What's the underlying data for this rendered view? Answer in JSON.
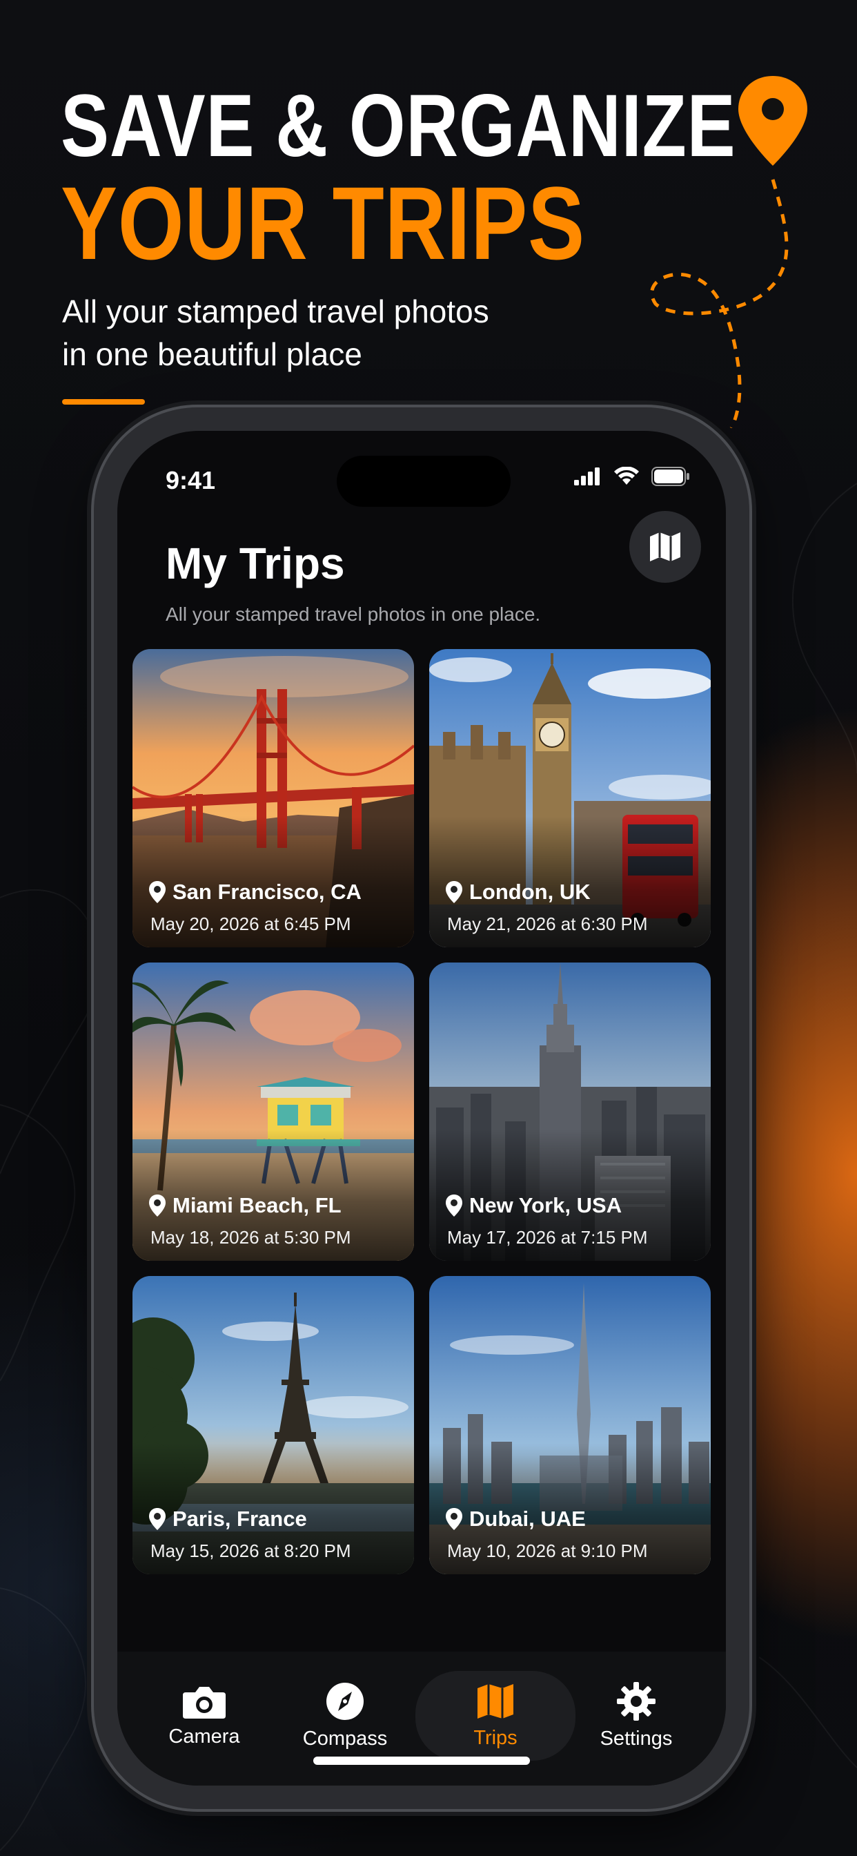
{
  "promo": {
    "headline_line1": "SAVE & ORGANIZE",
    "headline_line2": "YOUR TRIPS",
    "subhead_line1": "All your stamped travel photos",
    "subhead_line2": "in one beautiful place",
    "accent_color": "#ff8a00"
  },
  "status_bar": {
    "time": "9:41",
    "icons": [
      "signal-icon",
      "wifi-icon",
      "battery-icon"
    ]
  },
  "header": {
    "title": "My Trips",
    "subtitle": "All your stamped travel photos in one place.",
    "map_button_icon": "map-icon"
  },
  "trips": [
    {
      "location": "San Francisco, CA",
      "date": "May 20, 2026 at 6:45 PM",
      "photo": "golden-gate-bridge-sunset"
    },
    {
      "location": "London, UK",
      "date": "May 21, 2026 at 6:30 PM",
      "photo": "big-ben-red-bus"
    },
    {
      "location": "Miami Beach, FL",
      "date": "May 18, 2026 at 5:30 PM",
      "photo": "palm-tree-lifeguard-tower"
    },
    {
      "location": "New York, USA",
      "date": "May 17, 2026 at 7:15 PM",
      "photo": "empire-state-skyline"
    },
    {
      "location": "Paris, France",
      "date": "May 15, 2026 at 8:20 PM",
      "photo": "eiffel-tower-evening"
    },
    {
      "location": "Dubai, UAE",
      "date": "May 10, 2026 at 9:10 PM",
      "photo": "burj-khalifa-skyline"
    }
  ],
  "tabbar": {
    "items": [
      {
        "label": "Camera",
        "icon": "camera-icon",
        "active": false
      },
      {
        "label": "Compass",
        "icon": "compass-icon",
        "active": false
      },
      {
        "label": "Trips",
        "icon": "map-icon",
        "active": true
      },
      {
        "label": "Settings",
        "icon": "gear-icon",
        "active": false
      }
    ]
  }
}
